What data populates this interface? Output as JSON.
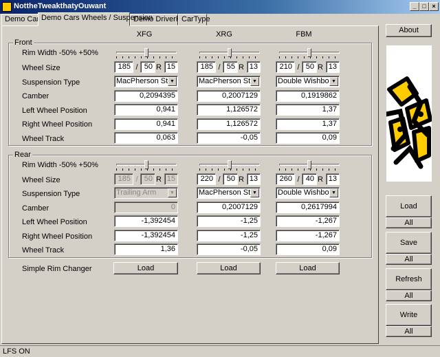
{
  "window": {
    "title": "NottheTweakthatyOuwant"
  },
  "tabs": [
    "Demo Cars",
    "Demo Cars Wheels / Suspension",
    "Demo DriverPos",
    "CarType"
  ],
  "columns": [
    "XFG",
    "XRG",
    "FBM"
  ],
  "front": {
    "group_label": "Front",
    "labels": {
      "rim_width": "Rim Width -50% +50%",
      "wheel_size": "Wheel Size",
      "suspension": "Suspension Type",
      "camber": "Camber",
      "left_pos": "Left Wheel Position",
      "right_pos": "Right Wheel Position",
      "track": "Wheel Track"
    },
    "cars": [
      {
        "rim_fraction": 0.5,
        "width": "185",
        "profile": "50",
        "rim": "15",
        "suspension": "MacPherson Strut",
        "camber": "0,2094395",
        "left": "0,941",
        "right": "0,941",
        "track": "0,063"
      },
      {
        "rim_fraction": 0.5,
        "width": "185",
        "profile": "55",
        "rim": "13",
        "suspension": "MacPherson Strut",
        "camber": "0,2007129",
        "left": "1,126572",
        "right": "1,126572",
        "track": "-0,05"
      },
      {
        "rim_fraction": 0.5,
        "width": "210",
        "profile": "50",
        "rim": "13",
        "suspension": "Double Wishbone",
        "camber": "0,1919862",
        "left": "1,37",
        "right": "1,37",
        "track": "0,09"
      }
    ]
  },
  "rear": {
    "group_label": "Rear",
    "labels": {
      "rim_width": "Rim Width -50% +50%",
      "wheel_size": "Wheel Size",
      "suspension": "Suspension Type",
      "camber": "Camber",
      "left_pos": "Left Wheel Position",
      "right_pos": "Right Wheel Position",
      "track": "Wheel Track"
    },
    "cars": [
      {
        "rim_fraction": 0.5,
        "width": "185",
        "profile": "50",
        "rim": "15",
        "suspension": "Trailing Arm",
        "camber": "0",
        "left": "-1,392454",
        "right": "-1,392454",
        "track": "1,36",
        "disabled": true
      },
      {
        "rim_fraction": 0.5,
        "width": "220",
        "profile": "50",
        "rim": "13",
        "suspension": "MacPherson Strut",
        "camber": "0,2007129",
        "left": "-1,25",
        "right": "-1,25",
        "track": "-0,05"
      },
      {
        "rim_fraction": 0.5,
        "width": "260",
        "profile": "40",
        "rim": "13",
        "suspension": "Double Wishbone",
        "camber": "0,2617994",
        "left": "-1,267",
        "right": "-1,267",
        "track": "0,09"
      }
    ]
  },
  "rim_changer": {
    "label": "Simple Rim Changer",
    "button": "Load"
  },
  "size_sep": "/",
  "rim_prefix": "R",
  "right_panel": {
    "about": "About",
    "load": "Load",
    "load_all": "All",
    "save": "Save",
    "save_all": "All",
    "refresh": "Refresh",
    "refresh_all": "All",
    "write": "Write",
    "write_all": "All"
  },
  "status": "LFS ON",
  "colors": {
    "title_bar": "#0a246a",
    "logo_yellow": "#ffcc00",
    "face": "#d4d0c8"
  }
}
